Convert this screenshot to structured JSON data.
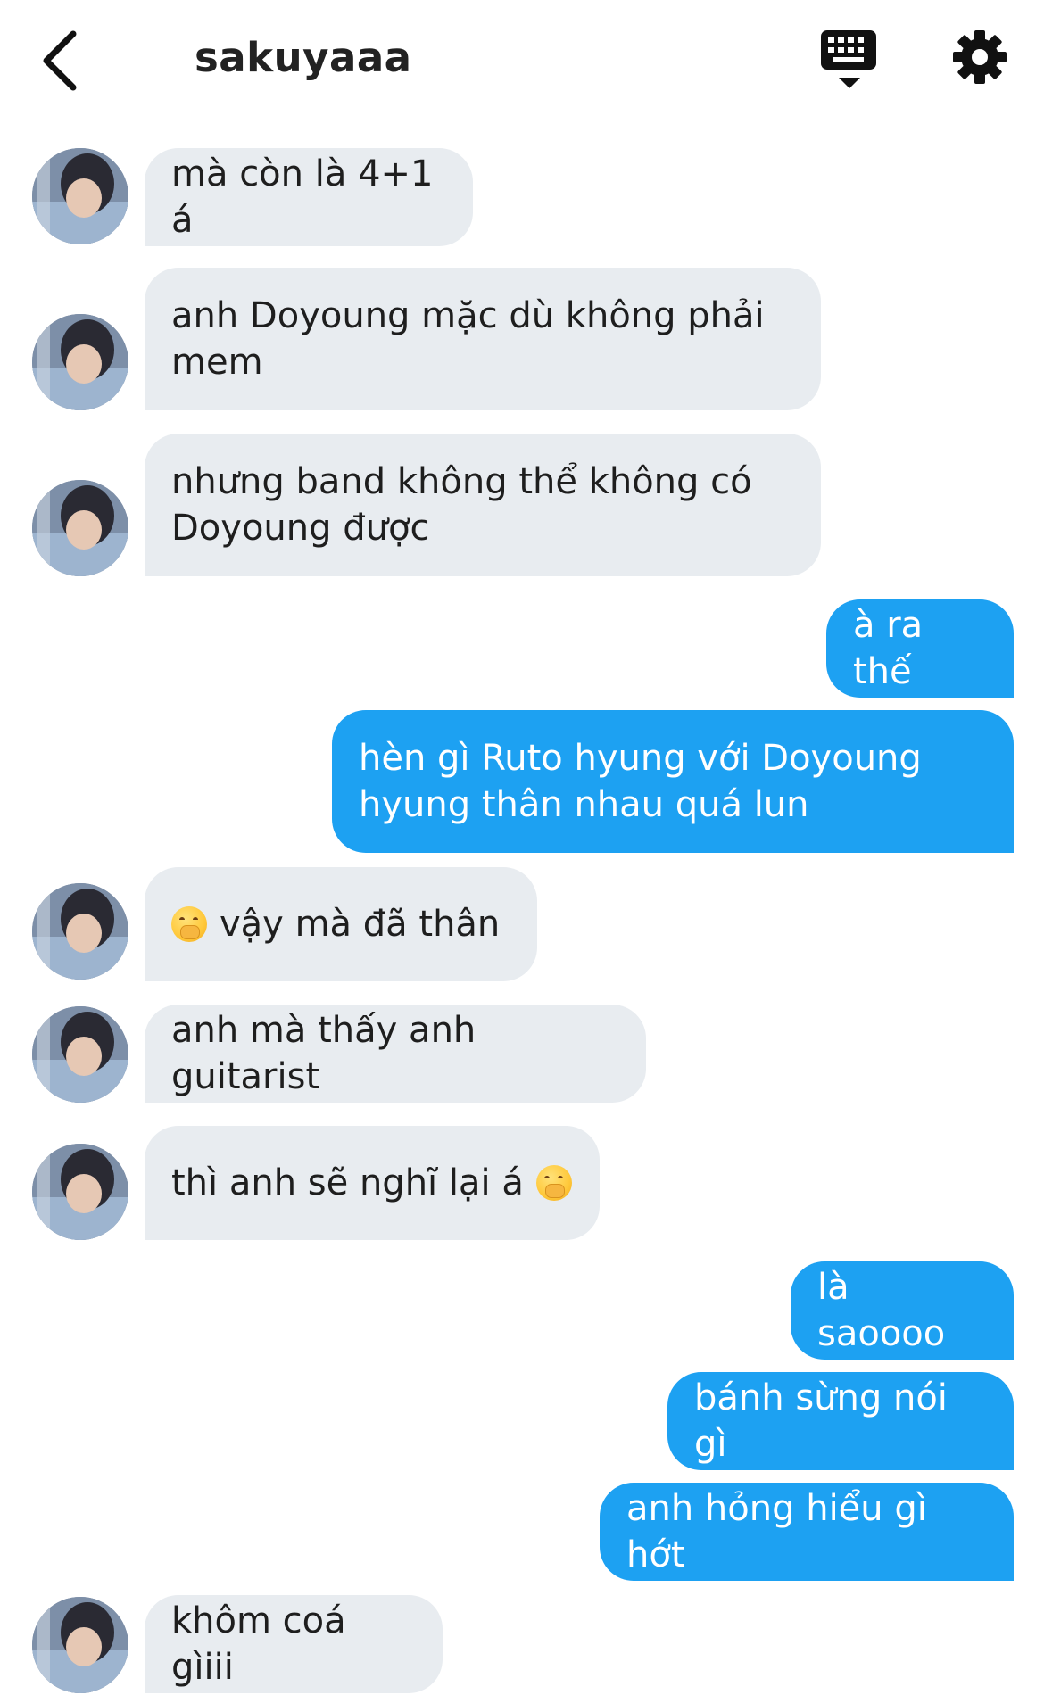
{
  "header": {
    "title": "sakuyaaa",
    "back_icon": "chevron-left-icon",
    "keyboard_icon": "keyboard-icon",
    "settings_icon": "gear-icon"
  },
  "colors": {
    "outgoing_bubble": "#1da1f2",
    "incoming_bubble": "#e8ecf0",
    "background": "#ffffff"
  },
  "messages": [
    {
      "direction": "in",
      "text": "mà còn là 4+1 á"
    },
    {
      "direction": "in",
      "text": "anh Doyoung mặc dù không phải\nmem"
    },
    {
      "direction": "in",
      "text": "nhưng band không thể không có\nDoyoung được"
    },
    {
      "direction": "out",
      "text": "à ra thế"
    },
    {
      "direction": "out",
      "text": "hèn gì Ruto hyung với Doyoung\nhyung thân nhau quá lun"
    },
    {
      "direction": "in",
      "text": "vậy mà đã thân",
      "emoji_before": "face-with-hand-over-mouth"
    },
    {
      "direction": "in",
      "text": "anh mà thấy anh guitarist"
    },
    {
      "direction": "in",
      "text": "thì anh sẽ nghĩ lại á",
      "emoji_after": "face-with-hand-over-mouth"
    },
    {
      "direction": "out",
      "text": "là saoooo"
    },
    {
      "direction": "out",
      "text": "bánh sừng nói gì"
    },
    {
      "direction": "out",
      "text": "anh hỏng hiểu gì hớt"
    },
    {
      "direction": "in",
      "text": "khôm coá gìiii"
    }
  ]
}
